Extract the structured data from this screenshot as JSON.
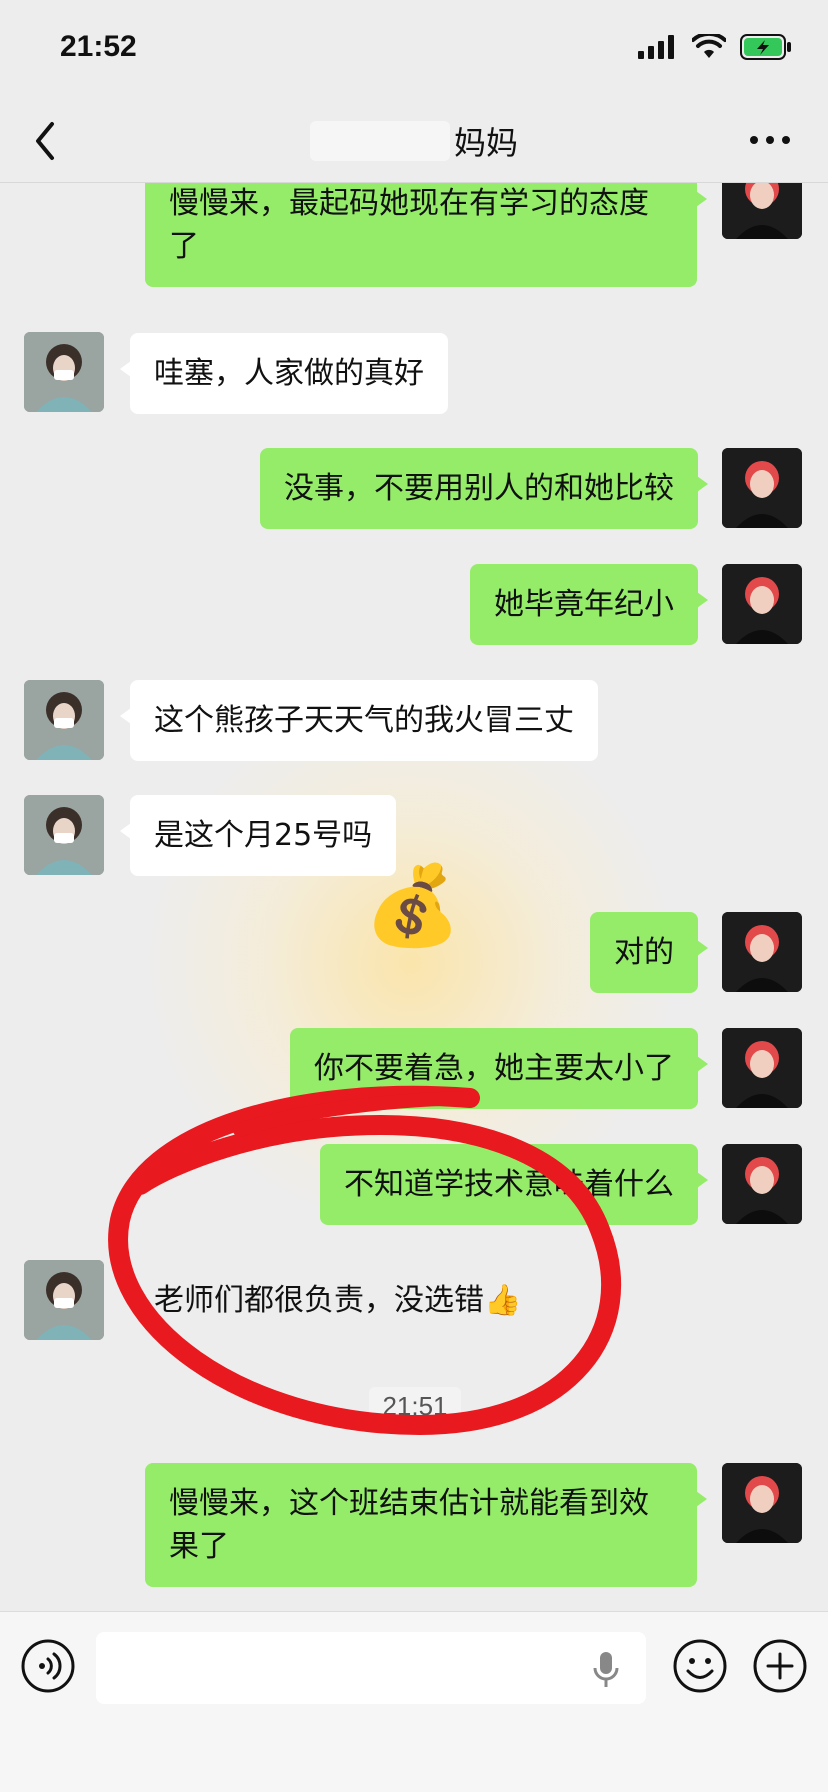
{
  "status_bar": {
    "time": "21:52"
  },
  "header": {
    "title": "妈妈"
  },
  "messages": [
    {
      "side": "mine",
      "text": "慢慢来，最起码她现在有学习的态度了"
    },
    {
      "side": "theirs",
      "text": "哇塞，人家做的真好"
    },
    {
      "side": "mine",
      "text": "没事，不要用别人的和她比较"
    },
    {
      "side": "mine",
      "text": "她毕竟年纪小"
    },
    {
      "side": "theirs",
      "text": "这个熊孩子天天气的我火冒三丈"
    },
    {
      "side": "theirs",
      "text": "是这个月25号吗"
    },
    {
      "side": "mine",
      "text": "对的"
    },
    {
      "side": "mine",
      "text": "你不要着急，她主要太小了"
    },
    {
      "side": "mine",
      "text": "不知道学技术意味着什么"
    },
    {
      "side": "theirs",
      "text": "老师们都很负责，没选错",
      "emoji": "👍"
    },
    {
      "side": "mine",
      "text": "慢慢来，这个班结束估计就能看到效果了"
    }
  ],
  "timestamp": "21:51",
  "decorations": {
    "money_bag_emoji": "💰"
  },
  "colors": {
    "my_bubble": "#95ec69",
    "their_bubble": "#ffffff",
    "background": "#ededed",
    "annotation_circle": "#e8191f"
  },
  "icons": [
    "back-arrow-icon",
    "more-dots-icon",
    "voice-icon",
    "microphone-icon",
    "emoji-icon",
    "plus-icon",
    "signal-icon",
    "wifi-icon",
    "battery-icon"
  ]
}
